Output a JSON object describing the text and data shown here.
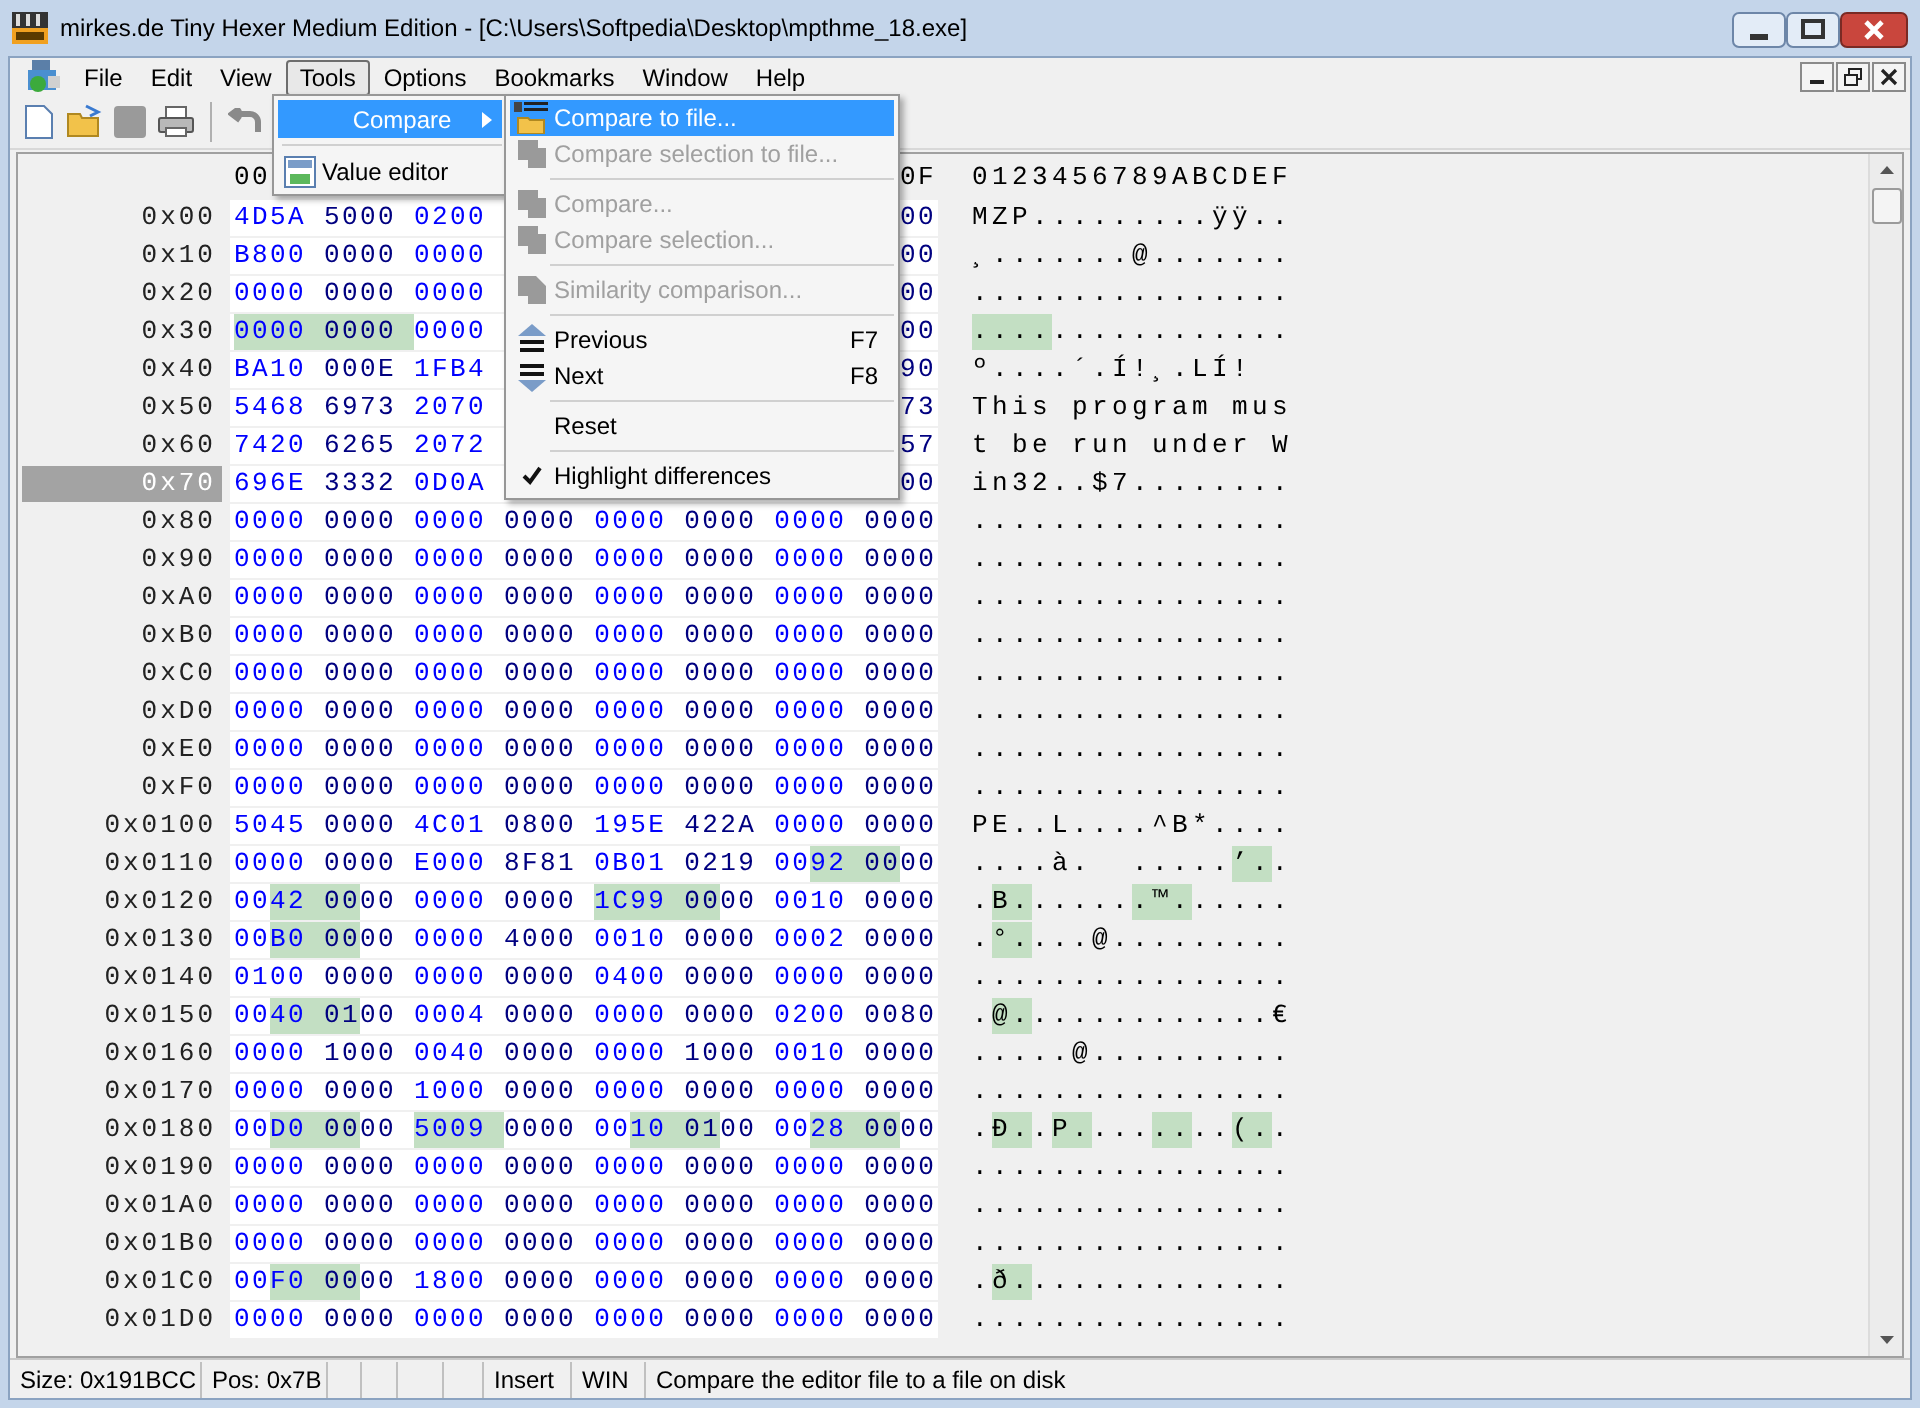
{
  "window": {
    "title": "mirkes.de Tiny Hexer Medium Edition - [C:\\Users\\Softpedia\\Desktop\\mpthme_18.exe]"
  },
  "menu_bar": {
    "items": [
      {
        "label": "File",
        "selected": false
      },
      {
        "label": "Edit",
        "selected": false
      },
      {
        "label": "View",
        "selected": false
      },
      {
        "label": "Tools",
        "selected": true
      },
      {
        "label": "Options",
        "selected": false
      },
      {
        "label": "Bookmarks",
        "selected": false
      },
      {
        "label": "Window",
        "selected": false
      },
      {
        "label": "Help",
        "selected": false
      }
    ]
  },
  "tools_menu": {
    "items": [
      {
        "kind": "item",
        "label": "Compare",
        "selected": true,
        "submenu": true
      },
      {
        "kind": "separator"
      },
      {
        "kind": "item",
        "label": "Value editor",
        "selected": false,
        "submenu": false
      }
    ]
  },
  "compare_submenu": {
    "items": [
      {
        "kind": "item",
        "label": "Compare to file...",
        "selected": true,
        "disabled": false,
        "checked": false
      },
      {
        "kind": "item",
        "label": "Compare selection to file...",
        "selected": false,
        "disabled": true,
        "checked": false
      },
      {
        "kind": "separator"
      },
      {
        "kind": "item",
        "label": "Compare...",
        "selected": false,
        "disabled": true,
        "checked": false
      },
      {
        "kind": "item",
        "label": "Compare selection...",
        "selected": false,
        "disabled": true,
        "checked": false
      },
      {
        "kind": "separator"
      },
      {
        "kind": "item",
        "label": "Similarity comparison...",
        "selected": false,
        "disabled": true,
        "checked": false
      },
      {
        "kind": "separator"
      },
      {
        "kind": "item",
        "label": "Previous",
        "shortcut": "F7",
        "selected": false,
        "disabled": false,
        "checked": false
      },
      {
        "kind": "item",
        "label": "Next",
        "shortcut": "F8",
        "selected": false,
        "disabled": false,
        "checked": false
      },
      {
        "kind": "separator"
      },
      {
        "kind": "item",
        "label": "Reset",
        "selected": false,
        "disabled": false,
        "checked": false
      },
      {
        "kind": "separator"
      },
      {
        "kind": "item",
        "label": "Highlight differences",
        "selected": false,
        "disabled": false,
        "checked": true
      }
    ]
  },
  "hex_view": {
    "hex_header": {
      "first": "00",
      "last": "0F"
    },
    "ascii_header": "0123456789ABCDEF",
    "rows": [
      {
        "offset": "0x00",
        "selected": false,
        "hex": [
          "4D5A",
          "5000",
          "0200"
        ],
        "hex_end": "00",
        "ascii": "MZP.........ÿÿ..",
        "changed": [
          false,
          false,
          false,
          false,
          false,
          false,
          false,
          false,
          false,
          false,
          false,
          false,
          false,
          false,
          false,
          false
        ]
      },
      {
        "offset": "0x10",
        "selected": false,
        "hex": [
          "B800",
          "0000",
          "0000"
        ],
        "hex_end": "00",
        "ascii": "¸.......@.......",
        "changed": [
          false,
          false,
          false,
          false,
          false,
          false,
          false,
          false,
          false,
          false,
          false,
          false,
          false,
          false,
          false,
          false
        ]
      },
      {
        "offset": "0x20",
        "selected": false,
        "hex": [
          "0000",
          "0000",
          "0000"
        ],
        "hex_end": "00",
        "ascii": "................",
        "changed": [
          false,
          false,
          false,
          false,
          false,
          false,
          false,
          false,
          false,
          false,
          false,
          false,
          false,
          false,
          false,
          false
        ]
      },
      {
        "offset": "0x30",
        "selected": false,
        "hex": [
          "0000",
          "0000",
          "0000"
        ],
        "hex_end": "00",
        "ascii": "................",
        "changed": [
          true,
          true,
          true,
          true,
          false,
          false,
          false,
          false,
          false,
          false,
          false,
          false,
          false,
          false,
          false,
          false
        ]
      },
      {
        "offset": "0x40",
        "selected": false,
        "hex": [
          "BA10",
          "000E",
          "1FB4"
        ],
        "hex_end": "90",
        "ascii": "º....´.Í!¸.LÍ!",
        "changed": [
          false,
          false,
          false,
          false,
          false,
          false,
          false,
          false,
          false,
          false,
          false,
          false,
          false,
          false,
          false,
          false
        ]
      },
      {
        "offset": "0x50",
        "selected": false,
        "hex": [
          "5468",
          "6973",
          "2070"
        ],
        "hex_end": "73",
        "ascii": "This program mus",
        "changed": [
          false,
          false,
          false,
          false,
          false,
          false,
          false,
          false,
          false,
          false,
          false,
          false,
          false,
          false,
          false,
          false
        ]
      },
      {
        "offset": "0x60",
        "selected": false,
        "hex": [
          "7420",
          "6265",
          "2072"
        ],
        "hex_end": "57",
        "ascii": "t be run under W",
        "changed": [
          false,
          false,
          false,
          false,
          false,
          false,
          false,
          false,
          false,
          false,
          false,
          false,
          false,
          false,
          false,
          false
        ]
      },
      {
        "offset": "0x70",
        "selected": true,
        "hex": [
          "696E",
          "3332",
          "0D0A"
        ],
        "hex_end": "00",
        "ascii": "in32..$7........",
        "changed": [
          false,
          false,
          false,
          false,
          false,
          false,
          false,
          false,
          false,
          false,
          false,
          false,
          false,
          false,
          false,
          false
        ]
      },
      {
        "offset": "0x80",
        "selected": false,
        "hex": [
          "0000",
          "0000",
          "0000",
          "0000",
          "0000",
          "0000",
          "0000",
          "0000"
        ],
        "ascii": "................",
        "changed": [
          false,
          false,
          false,
          false,
          false,
          false,
          false,
          false,
          false,
          false,
          false,
          false,
          false,
          false,
          false,
          false
        ]
      },
      {
        "offset": "0x90",
        "selected": false,
        "hex": [
          "0000",
          "0000",
          "0000",
          "0000",
          "0000",
          "0000",
          "0000",
          "0000"
        ],
        "ascii": "................",
        "changed": [
          false,
          false,
          false,
          false,
          false,
          false,
          false,
          false,
          false,
          false,
          false,
          false,
          false,
          false,
          false,
          false
        ]
      },
      {
        "offset": "0xA0",
        "selected": false,
        "hex": [
          "0000",
          "0000",
          "0000",
          "0000",
          "0000",
          "0000",
          "0000",
          "0000"
        ],
        "ascii": "................",
        "changed": [
          false,
          false,
          false,
          false,
          false,
          false,
          false,
          false,
          false,
          false,
          false,
          false,
          false,
          false,
          false,
          false
        ]
      },
      {
        "offset": "0xB0",
        "selected": false,
        "hex": [
          "0000",
          "0000",
          "0000",
          "0000",
          "0000",
          "0000",
          "0000",
          "0000"
        ],
        "ascii": "................",
        "changed": [
          false,
          false,
          false,
          false,
          false,
          false,
          false,
          false,
          false,
          false,
          false,
          false,
          false,
          false,
          false,
          false
        ]
      },
      {
        "offset": "0xC0",
        "selected": false,
        "hex": [
          "0000",
          "0000",
          "0000",
          "0000",
          "0000",
          "0000",
          "0000",
          "0000"
        ],
        "ascii": "................",
        "changed": [
          false,
          false,
          false,
          false,
          false,
          false,
          false,
          false,
          false,
          false,
          false,
          false,
          false,
          false,
          false,
          false
        ]
      },
      {
        "offset": "0xD0",
        "selected": false,
        "hex": [
          "0000",
          "0000",
          "0000",
          "0000",
          "0000",
          "0000",
          "0000",
          "0000"
        ],
        "ascii": "................",
        "changed": [
          false,
          false,
          false,
          false,
          false,
          false,
          false,
          false,
          false,
          false,
          false,
          false,
          false,
          false,
          false,
          false
        ]
      },
      {
        "offset": "0xE0",
        "selected": false,
        "hex": [
          "0000",
          "0000",
          "0000",
          "0000",
          "0000",
          "0000",
          "0000",
          "0000"
        ],
        "ascii": "................",
        "changed": [
          false,
          false,
          false,
          false,
          false,
          false,
          false,
          false,
          false,
          false,
          false,
          false,
          false,
          false,
          false,
          false
        ]
      },
      {
        "offset": "0xF0",
        "selected": false,
        "hex": [
          "0000",
          "0000",
          "0000",
          "0000",
          "0000",
          "0000",
          "0000",
          "0000"
        ],
        "ascii": "................",
        "changed": [
          false,
          false,
          false,
          false,
          false,
          false,
          false,
          false,
          false,
          false,
          false,
          false,
          false,
          false,
          false,
          false
        ]
      },
      {
        "offset": "0x0100",
        "selected": false,
        "hex": [
          "5045",
          "0000",
          "4C01",
          "0800",
          "195E",
          "422A",
          "0000",
          "0000"
        ],
        "ascii": "PE..L....^B*....",
        "changed": [
          false,
          false,
          false,
          false,
          false,
          false,
          false,
          false,
          false,
          false,
          false,
          false,
          false,
          false,
          false,
          false
        ]
      },
      {
        "offset": "0x0110",
        "selected": false,
        "hex": [
          "0000",
          "0000",
          "E000",
          "8F81",
          "0B01",
          "0219",
          "0092",
          "0000"
        ],
        "ascii": "....à.  .....’..",
        "changed": [
          false,
          false,
          false,
          false,
          false,
          false,
          false,
          false,
          false,
          false,
          false,
          false,
          false,
          true,
          true,
          false
        ]
      },
      {
        "offset": "0x0120",
        "selected": false,
        "hex": [
          "0042",
          "0000",
          "0000",
          "0000",
          "1C99",
          "0000",
          "0010",
          "0000"
        ],
        "ascii": ".B.......™......",
        "changed": [
          false,
          true,
          true,
          false,
          false,
          false,
          false,
          false,
          true,
          true,
          true,
          false,
          false,
          false,
          false,
          false
        ]
      },
      {
        "offset": "0x0130",
        "selected": false,
        "hex": [
          "00B0",
          "0000",
          "0000",
          "4000",
          "0010",
          "0000",
          "0002",
          "0000"
        ],
        "ascii": ".°....@.........",
        "changed": [
          false,
          true,
          true,
          false,
          false,
          false,
          false,
          false,
          false,
          false,
          false,
          false,
          false,
          false,
          false,
          false
        ]
      },
      {
        "offset": "0x0140",
        "selected": false,
        "hex": [
          "0100",
          "0000",
          "0000",
          "0000",
          "0400",
          "0000",
          "0000",
          "0000"
        ],
        "ascii": "................",
        "changed": [
          false,
          false,
          false,
          false,
          false,
          false,
          false,
          false,
          false,
          false,
          false,
          false,
          false,
          false,
          false,
          false
        ]
      },
      {
        "offset": "0x0150",
        "selected": false,
        "hex": [
          "0040",
          "0100",
          "0004",
          "0000",
          "0000",
          "0000",
          "0200",
          "0080"
        ],
        "ascii": ".@.............€",
        "changed": [
          false,
          true,
          true,
          false,
          false,
          false,
          false,
          false,
          false,
          false,
          false,
          false,
          false,
          false,
          false,
          false
        ]
      },
      {
        "offset": "0x0160",
        "selected": false,
        "hex": [
          "0000",
          "1000",
          "0040",
          "0000",
          "0000",
          "1000",
          "0010",
          "0000"
        ],
        "ascii": ".....@..........",
        "changed": [
          false,
          false,
          false,
          false,
          false,
          false,
          false,
          false,
          false,
          false,
          false,
          false,
          false,
          false,
          false,
          false
        ]
      },
      {
        "offset": "0x0170",
        "selected": false,
        "hex": [
          "0000",
          "0000",
          "1000",
          "0000",
          "0000",
          "0000",
          "0000",
          "0000"
        ],
        "ascii": "................",
        "changed": [
          false,
          false,
          false,
          false,
          false,
          false,
          false,
          false,
          false,
          false,
          false,
          false,
          false,
          false,
          false,
          false
        ]
      },
      {
        "offset": "0x0180",
        "selected": false,
        "hex": [
          "00D0",
          "0000",
          "5009",
          "0000",
          "0010",
          "0100",
          "0028",
          "0000"
        ],
        "ascii": ".Ð..P........(..",
        "changed": [
          false,
          true,
          true,
          false,
          true,
          true,
          false,
          false,
          false,
          true,
          true,
          false,
          false,
          true,
          true,
          false
        ]
      },
      {
        "offset": "0x0190",
        "selected": false,
        "hex": [
          "0000",
          "0000",
          "0000",
          "0000",
          "0000",
          "0000",
          "0000",
          "0000"
        ],
        "ascii": "................",
        "changed": [
          false,
          false,
          false,
          false,
          false,
          false,
          false,
          false,
          false,
          false,
          false,
          false,
          false,
          false,
          false,
          false
        ]
      },
      {
        "offset": "0x01A0",
        "selected": false,
        "hex": [
          "0000",
          "0000",
          "0000",
          "0000",
          "0000",
          "0000",
          "0000",
          "0000"
        ],
        "ascii": "................",
        "changed": [
          false,
          false,
          false,
          false,
          false,
          false,
          false,
          false,
          false,
          false,
          false,
          false,
          false,
          false,
          false,
          false
        ]
      },
      {
        "offset": "0x01B0",
        "selected": false,
        "hex": [
          "0000",
          "0000",
          "0000",
          "0000",
          "0000",
          "0000",
          "0000",
          "0000"
        ],
        "ascii": "................",
        "changed": [
          false,
          false,
          false,
          false,
          false,
          false,
          false,
          false,
          false,
          false,
          false,
          false,
          false,
          false,
          false,
          false
        ]
      },
      {
        "offset": "0x01C0",
        "selected": false,
        "hex": [
          "00F0",
          "0000",
          "1800",
          "0000",
          "0000",
          "0000",
          "0000",
          "0000"
        ],
        "ascii": ".ð..............",
        "changed": [
          false,
          true,
          true,
          false,
          false,
          false,
          false,
          false,
          false,
          false,
          false,
          false,
          false,
          false,
          false,
          false
        ]
      },
      {
        "offset": "0x01D0",
        "selected": false,
        "hex": [
          "0000",
          "0000",
          "0000",
          "0000",
          "0000",
          "0000",
          "0000",
          "0000"
        ],
        "ascii": "................",
        "changed": [
          false,
          false,
          false,
          false,
          false,
          false,
          false,
          false,
          false,
          false,
          false,
          false,
          false,
          false,
          false,
          false
        ]
      }
    ]
  },
  "status_bar": {
    "size": "Size: 0x191BCC",
    "position": "Pos: 0x7B",
    "mode": "Insert",
    "charset": "WIN",
    "message": "Compare the editor file to a file on disk"
  }
}
